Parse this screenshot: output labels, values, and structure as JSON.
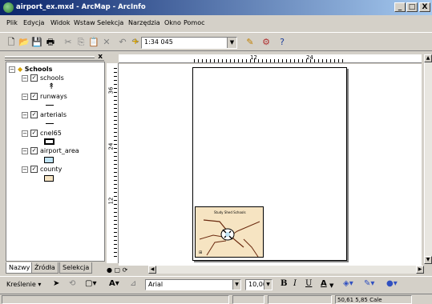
{
  "window": {
    "title": "airport_ex.mxd - ArcMap - ArcInfo",
    "minimize": "_",
    "maximize": "□",
    "close": "X"
  },
  "menu": [
    "Plik",
    "Edycja",
    "Widok",
    "Wstaw",
    "Selekcja",
    "Narzędzia",
    "Okno",
    "Pomoc"
  ],
  "toolbar": {
    "scale": "1:34 045",
    "icons": [
      "new-icon",
      "open-icon",
      "save-icon",
      "print-icon",
      "cut-icon",
      "copy-icon",
      "paste-icon",
      "delete-icon",
      "undo-icon",
      "redo-icon",
      "add-data-icon",
      "editor-icon",
      "arc-toolbox-icon",
      "whats-this-icon"
    ]
  },
  "toc": {
    "close": "x",
    "group": "Schools",
    "layers": [
      {
        "name": "schools"
      },
      {
        "name": "runways"
      },
      {
        "name": "arterials"
      },
      {
        "name": "cnel65"
      },
      {
        "name": "airport_area"
      },
      {
        "name": "county"
      }
    ],
    "tabs": [
      "Nazwy",
      "Źródła",
      "Selekcja"
    ]
  },
  "ruler": {
    "h": [
      "12",
      "24"
    ],
    "v": [
      "36",
      "24",
      "12"
    ]
  },
  "map": {
    "label": "Study Shed Schools"
  },
  "drawbar": {
    "label": "Kreślenie",
    "font": "Arial",
    "size": "10,00",
    "bold": "B",
    "italic": "I",
    "underline": "U",
    "fontcolor": "A"
  },
  "status": {
    "coords": "50,61  5,85 Cale"
  },
  "colors": {
    "titlebar_start": "#0a246a",
    "cnel_fill": "#ffffff",
    "airport_fill": "#bfe3f5",
    "county_fill": "#f6e4c2"
  }
}
